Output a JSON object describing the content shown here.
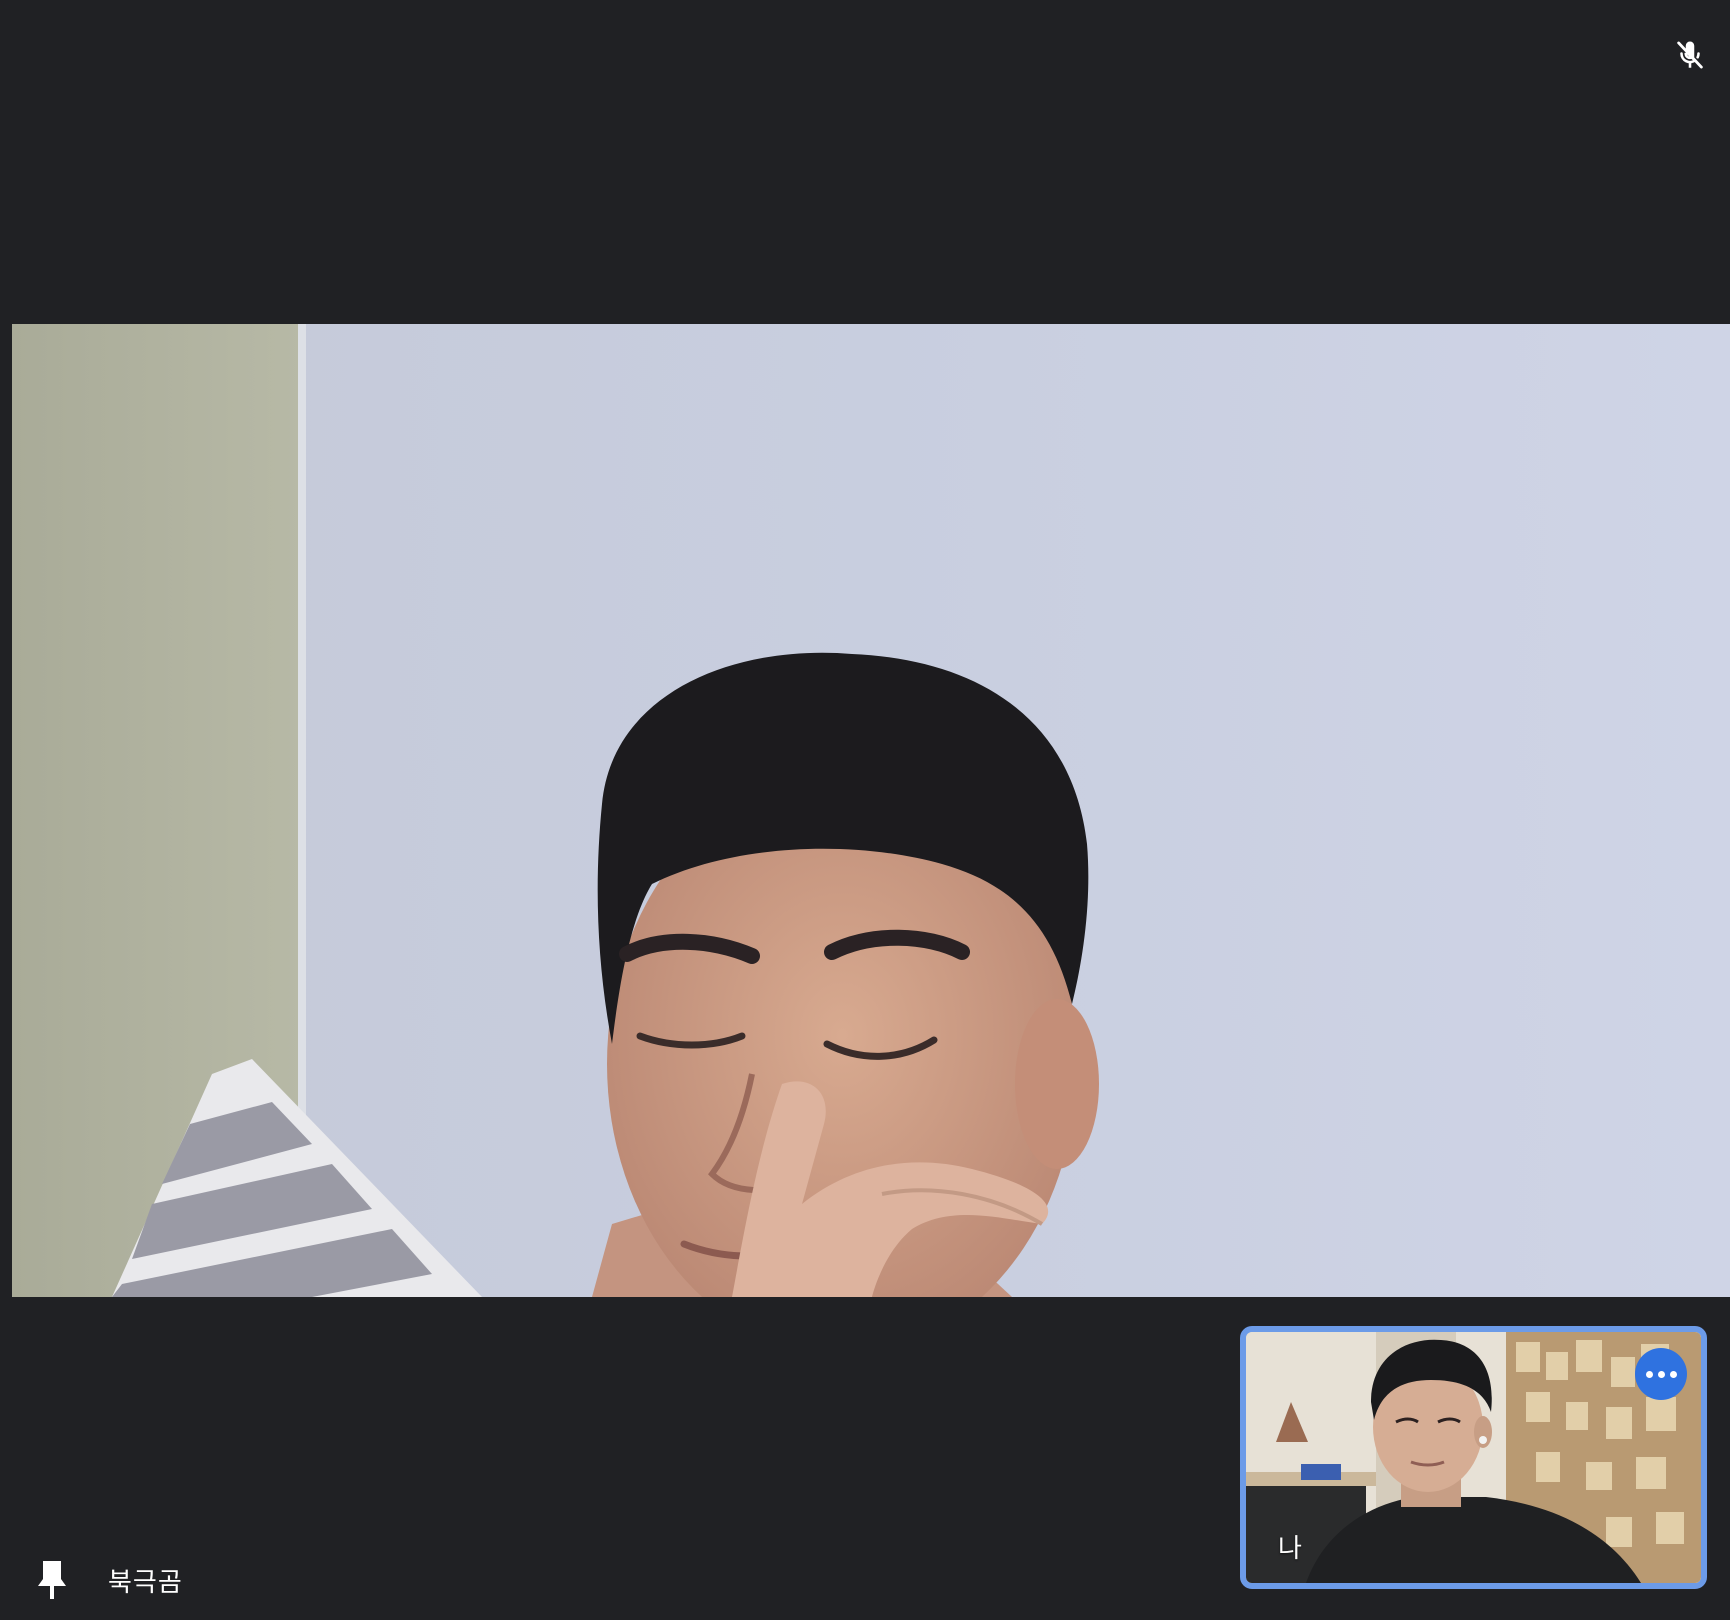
{
  "meeting": {
    "main_participant": {
      "name": "북극곰",
      "mic_state": "muted",
      "pin_icon": "pin-icon"
    },
    "self_view": {
      "label": "나",
      "more_icon": "more-horiz-icon"
    }
  },
  "colors": {
    "background": "#202124",
    "self_view_border": "#6c9be8",
    "more_button": "#2f72e0"
  }
}
